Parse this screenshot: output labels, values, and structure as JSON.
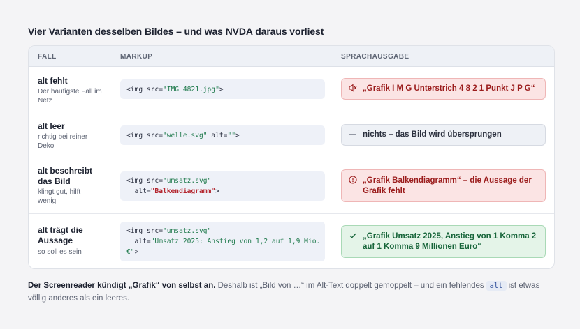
{
  "heading": "Vier Varianten desselben Bildes – und was NVDA daraus vorliest",
  "columns": {
    "case": "FALL",
    "markup": "MARKUP",
    "speech": "SPRACHAUSGABE"
  },
  "rows": [
    {
      "title": "alt fehlt",
      "subtitle": "Der häufigste Fall im Netz",
      "code": {
        "l1_pre": "<img src=",
        "l1_str": "\"IMG_4821.jpg\"",
        "l1_post": ">"
      },
      "speech": "„Grafik I M G Unterstrich 4 8 2 1 Punkt J P G“",
      "icon": "muted-speaker-icon",
      "status": "error"
    },
    {
      "title": "alt leer",
      "subtitle": "richtig bei reiner Deko",
      "code": {
        "l1_pre": "<img src=",
        "l1_str": "\"welle.svg\"",
        "l1_mid": " alt=",
        "l1_str2": "\"\"",
        "l1_post": ">"
      },
      "speech": "nichts – das Bild wird übersprungen",
      "icon": "dash-icon",
      "status": "neutral"
    },
    {
      "title": "alt beschreibt das Bild",
      "subtitle": "klingt gut, hilft wenig",
      "code": {
        "l1_pre": "<img src=",
        "l1_str": "\"umsatz.svg\"",
        "l2_pre": "  alt=",
        "l2_str": "\"Balkendiagramm\"",
        "l2_post": ">"
      },
      "speech": "„Grafik Balkendiagramm“ – die Aussage der Grafik fehlt",
      "icon": "alert-circle-icon",
      "status": "error"
    },
    {
      "title": "alt trägt die Aussage",
      "subtitle": "so soll es sein",
      "code": {
        "l1_pre": "<img src=",
        "l1_str": "\"umsatz.svg\"",
        "l2_pre": "  alt=",
        "l2_str": "\"Umsatz 2025: Anstieg von 1,2 auf 1,9 Mio.",
        "l3_str": "€\"",
        "l3_post": ">"
      },
      "speech": "„Grafik Umsatz 2025, Anstieg von 1 Komma 2 auf 1 Komma 9 Millionen Euro“",
      "icon": "check-icon",
      "status": "ok"
    }
  ],
  "footer": {
    "bold": "Der Screenreader kündigt „Grafik“ von selbst an.",
    "text1": " Deshalb ist „Bild von …“ im Alt-Text doppelt gemoppelt – und ein fehlendes",
    "code": "alt",
    "text2": "ist etwas völlig anderes als ein leeres."
  },
  "colors": {
    "error": "#9b1c1c",
    "ok": "#17653a",
    "accent_code": "#2f4f9a"
  }
}
